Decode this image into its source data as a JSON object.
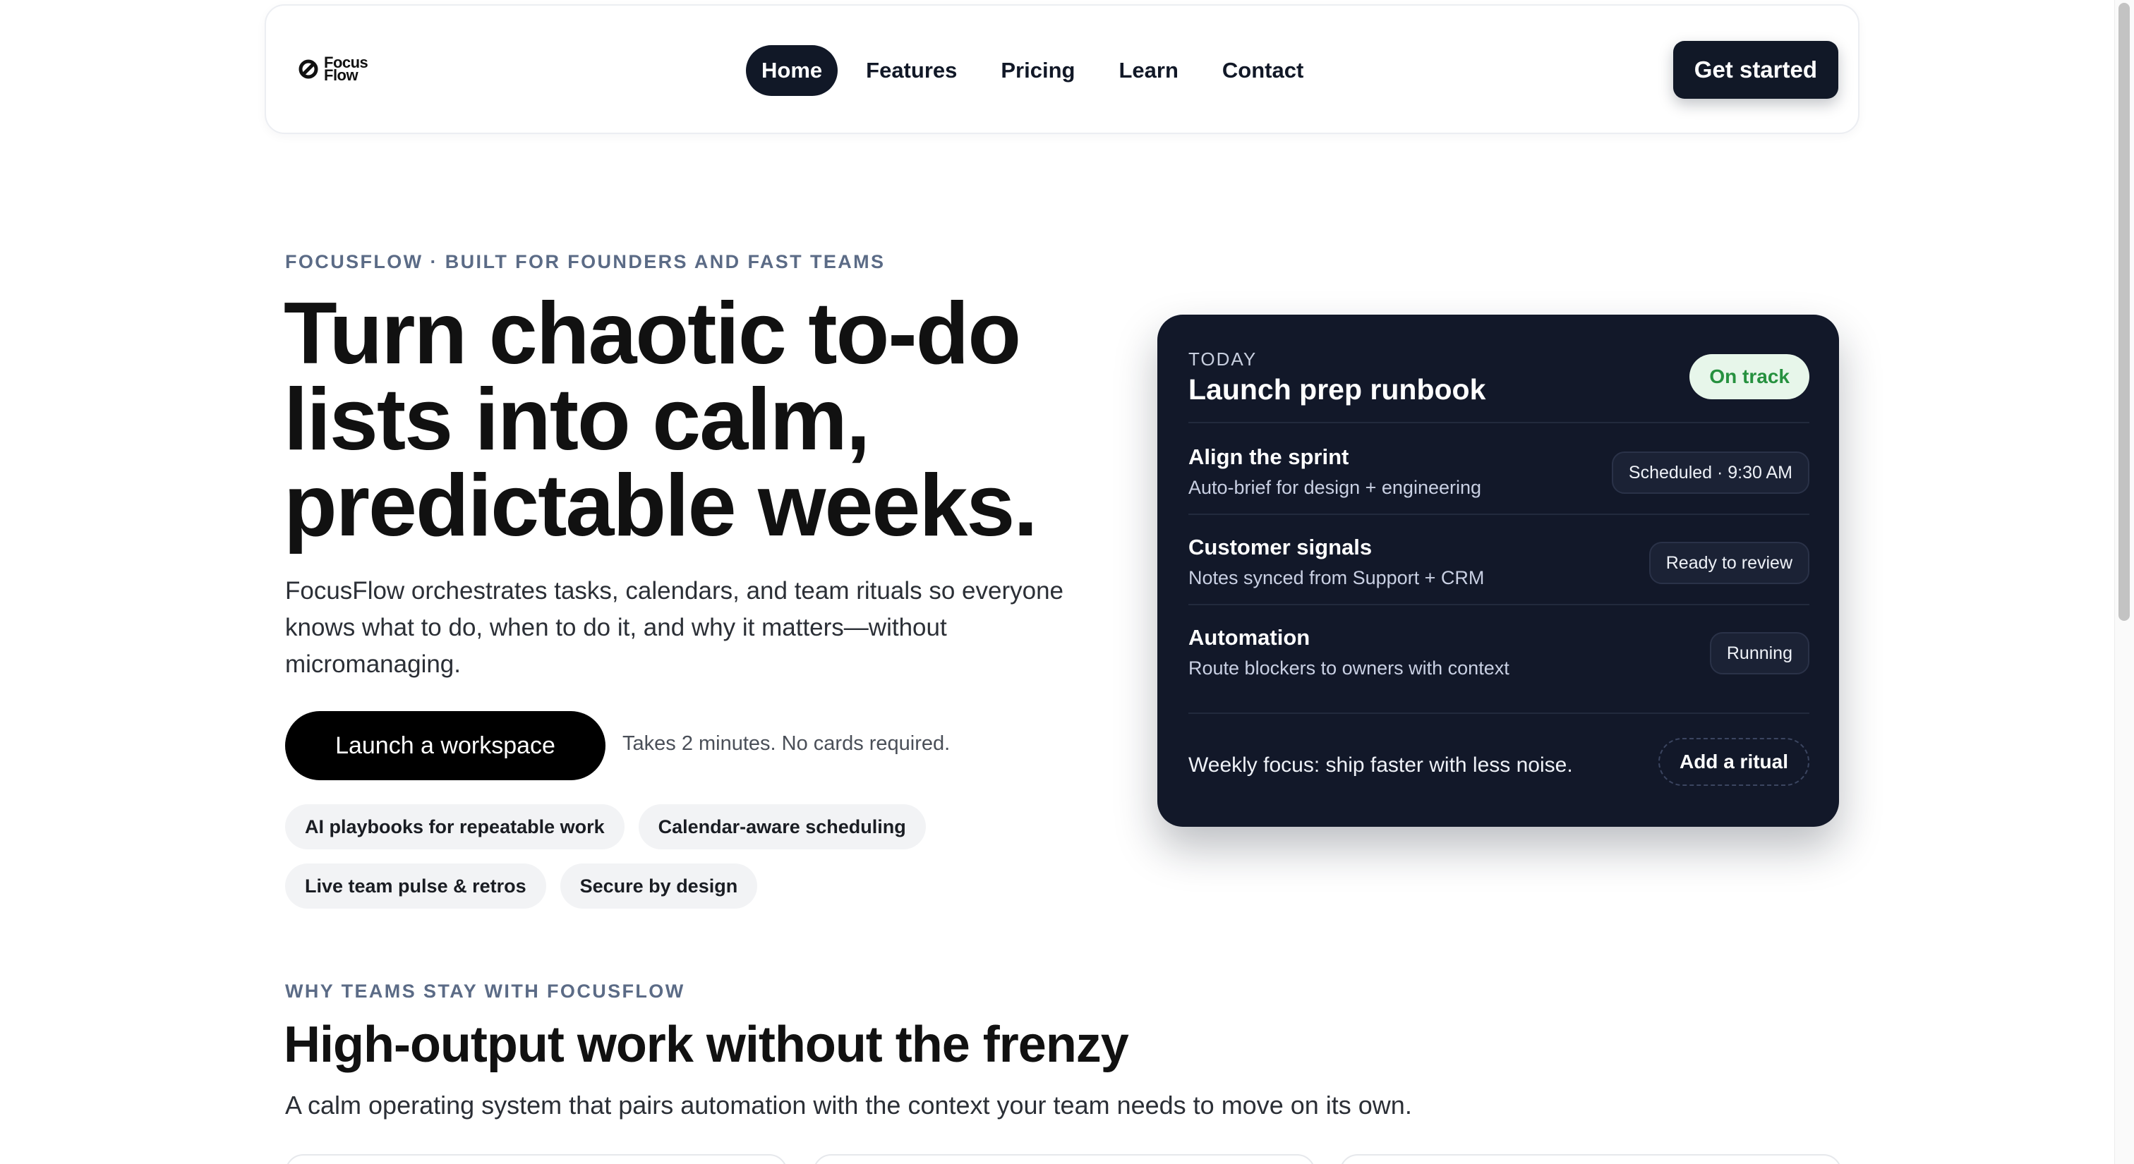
{
  "nav": {
    "logo_line1": "Focus",
    "logo_line2": "Flow",
    "links": [
      "Home",
      "Features",
      "Pricing",
      "Learn",
      "Contact"
    ],
    "cta": "Get started"
  },
  "hero": {
    "eyebrow": "FOCUSFLOW · BUILT FOR FOUNDERS AND FAST TEAMS",
    "title": "Turn chaotic to-do lists into calm, predictable weeks.",
    "subtitle": "FocusFlow orchestrates tasks, calendars, and team rituals so everyone knows what to do, when to do it, and why it matters—without micromanaging.",
    "launch_button": "Launch a workspace",
    "launch_note": "Takes 2 minutes. No cards required.",
    "chips": [
      "AI playbooks for repeatable work",
      "Calendar-aware scheduling",
      "Live team pulse & retros",
      "Secure by design"
    ]
  },
  "card": {
    "label": "TODAY",
    "title": "Launch prep runbook",
    "status": "On track",
    "rows": [
      {
        "title": "Align the sprint",
        "desc": "Auto-brief for design + engineering",
        "tag": "Scheduled · 9:30 AM"
      },
      {
        "title": "Customer signals",
        "desc": "Notes synced from Support + CRM",
        "tag": "Ready to review"
      },
      {
        "title": "Automation",
        "desc": "Route blockers to owners with context",
        "tag": "Running"
      }
    ],
    "weekly": "Weekly focus: ship faster with less noise.",
    "ritual_button": "Add a ritual"
  },
  "why": {
    "eyebrow": "WHY TEAMS STAY WITH FOCUSFLOW",
    "title": "High-output work without the frenzy",
    "subtitle": "A calm operating system that pairs automation with the context your team needs to move on its own."
  },
  "colors": {
    "accent_dark": "#111827",
    "card_bg": "#121829",
    "status_green": "#26913f",
    "eyebrow": "#5b6b86"
  }
}
